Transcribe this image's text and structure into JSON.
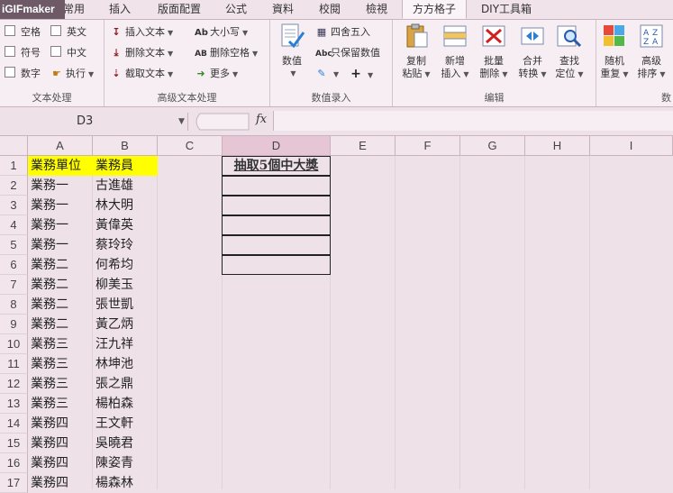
{
  "watermark": "iGIFmaker",
  "tabs": [
    {
      "label": "常用"
    },
    {
      "label": "插入"
    },
    {
      "label": "版面配置"
    },
    {
      "label": "公式"
    },
    {
      "label": "資料"
    },
    {
      "label": "校閱"
    },
    {
      "label": "檢視"
    },
    {
      "label": "方方格子",
      "active": true
    },
    {
      "label": "DIY工具箱"
    }
  ],
  "ribbon": {
    "text_group": {
      "title": "文本处理",
      "items": [
        "空格",
        "英文",
        "符号",
        "中文",
        "数字",
        "执行"
      ]
    },
    "adv_group": {
      "title": "高级文本处理",
      "items": [
        "插入文本",
        "大小写",
        "删除文本",
        "删除空格",
        "截取文本",
        "更多"
      ]
    },
    "value_group": {
      "title": "数值录入",
      "big_label": "数值",
      "items": [
        "四舍五入",
        "只保留数值"
      ]
    },
    "edit_group": {
      "title": "编辑",
      "buttons": [
        {
          "l1": "复制",
          "l2": "粘贴"
        },
        {
          "l1": "新增",
          "l2": "插入"
        },
        {
          "l1": "批量",
          "l2": "删除"
        },
        {
          "l1": "合并",
          "l2": "转换"
        },
        {
          "l1": "查找",
          "l2": "定位"
        }
      ]
    },
    "data_group": {
      "title": "数",
      "buttons": [
        {
          "l1": "随机",
          "l2": "重复"
        },
        {
          "l1": "高级",
          "l2": "排序"
        }
      ]
    }
  },
  "formula_bar": {
    "name_box": "D3",
    "fx": "fx",
    "formula": ""
  },
  "columns": [
    "A",
    "B",
    "C",
    "D",
    "E",
    "F",
    "G",
    "H",
    "I"
  ],
  "rows": [
    {
      "num": "1",
      "a": "業務單位",
      "b": "業務員"
    },
    {
      "num": "2",
      "a": "業務一",
      "b": "古進雄"
    },
    {
      "num": "3",
      "a": "業務一",
      "b": "林大明"
    },
    {
      "num": "4",
      "a": "業務一",
      "b": "黃偉英"
    },
    {
      "num": "5",
      "a": "業務一",
      "b": "蔡玲玲"
    },
    {
      "num": "6",
      "a": "業務二",
      "b": "何希均"
    },
    {
      "num": "7",
      "a": "業務二",
      "b": "柳美玉"
    },
    {
      "num": "8",
      "a": "業務二",
      "b": "張世凱"
    },
    {
      "num": "9",
      "a": "業務二",
      "b": "黃乙炳"
    },
    {
      "num": "10",
      "a": "業務三",
      "b": "汪九祥"
    },
    {
      "num": "11",
      "a": "業務三",
      "b": "林坤池"
    },
    {
      "num": "12",
      "a": "業務三",
      "b": "張之鼎"
    },
    {
      "num": "13",
      "a": "業務三",
      "b": "楊柏森"
    },
    {
      "num": "14",
      "a": "業務四",
      "b": "王文軒"
    },
    {
      "num": "15",
      "a": "業務四",
      "b": "吳曉君"
    },
    {
      "num": "16",
      "a": "業務四",
      "b": "陳姿青"
    },
    {
      "num": "17",
      "a": "業務四",
      "b": "楊森林"
    }
  ],
  "prize_box": {
    "title": "抽取5個中大獎",
    "slots": [
      "",
      "",
      "",
      "",
      ""
    ]
  },
  "colors": {
    "header_highlight": "#ffff00",
    "background": "#efe1e8"
  }
}
